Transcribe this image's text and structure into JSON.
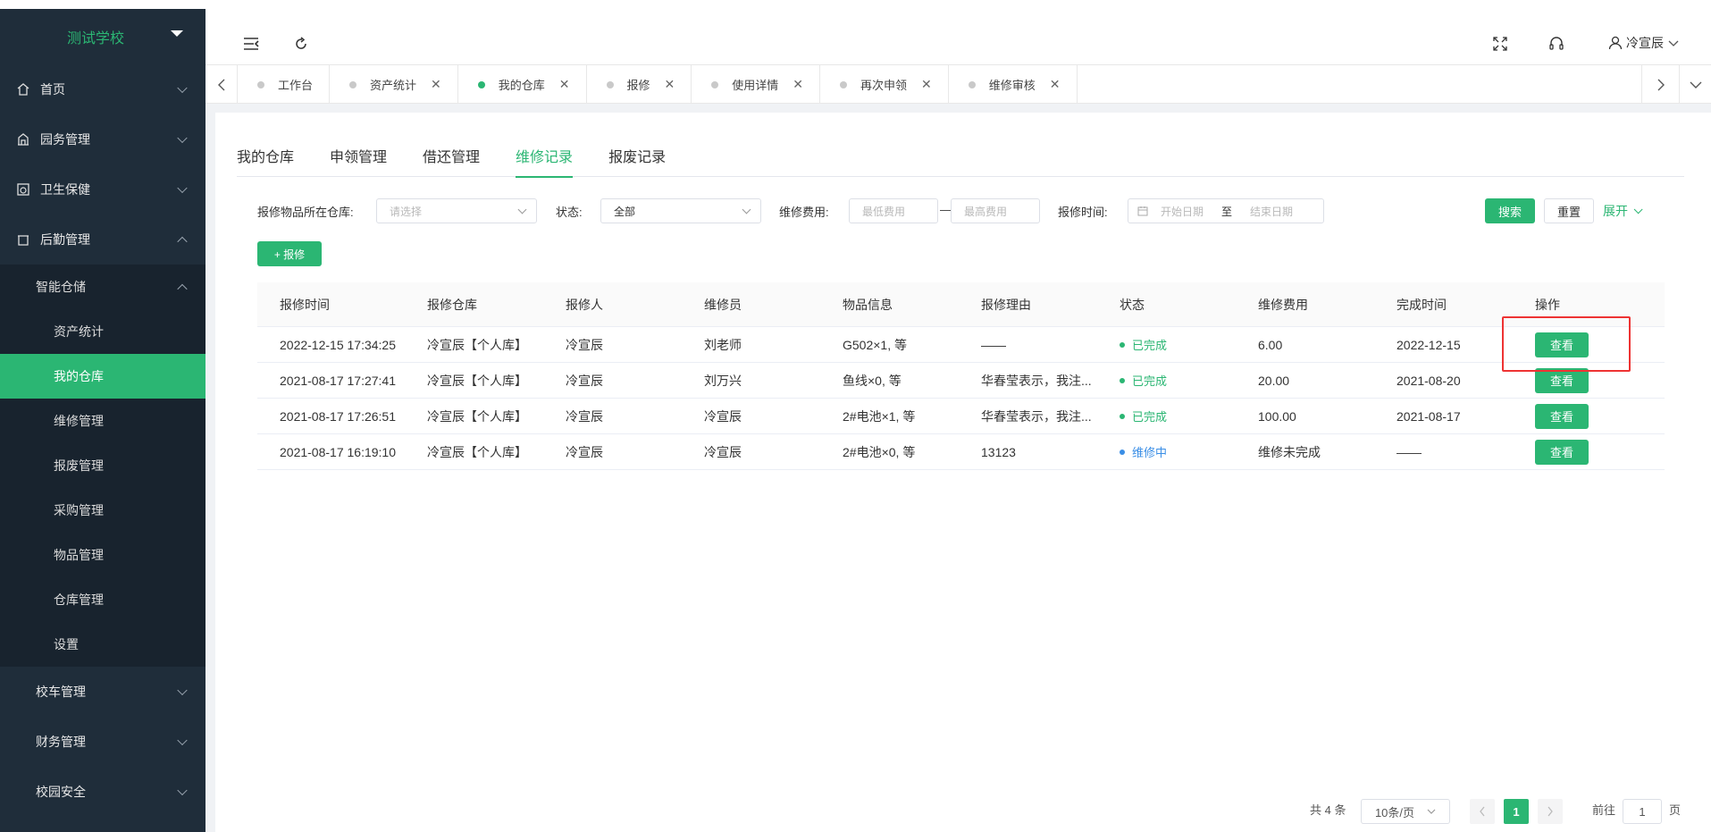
{
  "app": {
    "school_name": "测试学校"
  },
  "sidebar": {
    "menus": [
      {
        "label": "首页",
        "icon": "home-icon"
      },
      {
        "label": "园务管理",
        "icon": "building-icon"
      },
      {
        "label": "卫生保健",
        "icon": "health-icon"
      },
      {
        "label": "后勤管理",
        "icon": "logistics-icon"
      }
    ],
    "logistics_sub": {
      "label": "智能仓储",
      "items": [
        "资产统计",
        "我的仓库",
        "维修管理",
        "报废管理",
        "采购管理",
        "物品管理",
        "仓库管理",
        "设置"
      ],
      "active": "我的仓库"
    },
    "bottom_menus": [
      "校车管理",
      "财务管理",
      "校园安全"
    ]
  },
  "header": {
    "user_name": "冷宣辰"
  },
  "tabs": [
    {
      "label": "工作台",
      "closable": false
    },
    {
      "label": "资产统计",
      "closable": true
    },
    {
      "label": "我的仓库",
      "closable": true,
      "active": true
    },
    {
      "label": "报修",
      "closable": true
    },
    {
      "label": "使用详情",
      "closable": true
    },
    {
      "label": "再次申领",
      "closable": true
    },
    {
      "label": "维修审核",
      "closable": true
    }
  ],
  "subtabs": [
    "我的仓库",
    "申领管理",
    "借还管理",
    "维修记录",
    "报废记录"
  ],
  "active_subtab": "维修记录",
  "filters": {
    "warehouse_label": "报修物品所在仓库:",
    "warehouse_placeholder": "请选择",
    "status_label": "状态:",
    "status_value": "全部",
    "cost_label": "维修费用:",
    "cost_min_placeholder": "最低费用",
    "cost_sep": "—",
    "cost_max_placeholder": "最高费用",
    "time_label": "报修时间:",
    "start_placeholder": "开始日期",
    "range_sep": "至",
    "end_placeholder": "结束日期",
    "search_label": "搜索",
    "reset_label": "重置",
    "expand_label": "展开"
  },
  "add_repair_label": "+ 报修",
  "table": {
    "headers": [
      "报修时间",
      "报修仓库",
      "报修人",
      "维修员",
      "物品信息",
      "报修理由",
      "状态",
      "维修费用",
      "完成时间",
      "操作"
    ],
    "rows": [
      {
        "time": "2022-12-15 17:34:25",
        "warehouse": "冷宣辰【个人库】",
        "reporter": "冷宣辰",
        "repairer": "刘老师",
        "items": "G502×1, 等",
        "reason": "——",
        "status": "已完成",
        "status_type": "done",
        "cost": "6.00",
        "finish": "2022-12-15",
        "action": "查看"
      },
      {
        "time": "2021-08-17 17:27:41",
        "warehouse": "冷宣辰【个人库】",
        "reporter": "冷宣辰",
        "repairer": "刘万兴",
        "items": "鱼线×0, 等",
        "reason": "华春莹表示，我注...",
        "status": "已完成",
        "status_type": "done",
        "cost": "20.00",
        "finish": "2021-08-20",
        "action": "查看"
      },
      {
        "time": "2021-08-17 17:26:51",
        "warehouse": "冷宣辰【个人库】",
        "reporter": "冷宣辰",
        "repairer": "冷宣辰",
        "items": "2#电池×1, 等",
        "reason": "华春莹表示，我注...",
        "status": "已完成",
        "status_type": "done",
        "cost": "100.00",
        "finish": "2021-08-17",
        "action": "查看"
      },
      {
        "time": "2021-08-17 16:19:10",
        "warehouse": "冷宣辰【个人库】",
        "reporter": "冷宣辰",
        "repairer": "冷宣辰",
        "items": "2#电池×0, 等",
        "reason": "13123",
        "status": "维修中",
        "status_type": "doing",
        "cost": "维修未完成",
        "finish": "——",
        "action": "查看"
      }
    ]
  },
  "pagination": {
    "total": "共 4 条",
    "page_size": "10条/页",
    "current_page": "1",
    "goto_label": "前往",
    "goto_value": "1",
    "page_unit": "页"
  },
  "colors": {
    "accent": "#2bb673",
    "sidebar_bg": "#1f2d3a",
    "status_doing": "#3a8ee6",
    "highlight_box": "#ee3333"
  }
}
